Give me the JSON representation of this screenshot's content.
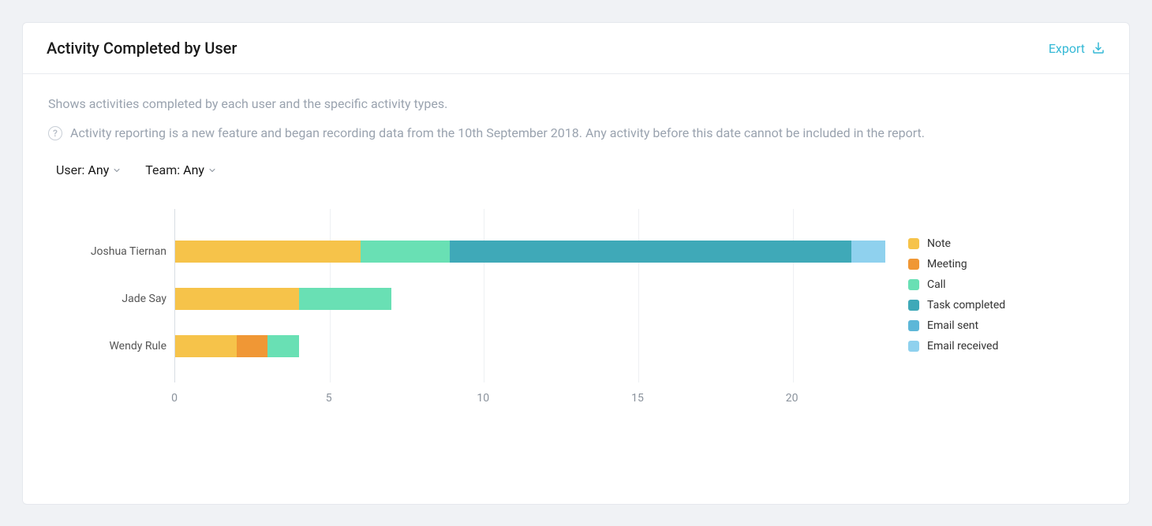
{
  "header": {
    "title": "Activity Completed by User",
    "export_label": "Export"
  },
  "body": {
    "description": "Shows activities completed by each user and the specific activity types.",
    "info_note": "Activity reporting is a new feature and began recording data from the 10th September 2018. Any activity before this date cannot be included in the report."
  },
  "filters": {
    "user": {
      "label": "User:",
      "value": "Any"
    },
    "team": {
      "label": "Team:",
      "value": "Any"
    }
  },
  "chart_data": {
    "type": "bar",
    "orientation": "horizontal",
    "stacked": true,
    "categories": [
      "Joshua Tiernan",
      "Jade Say",
      "Wendy Rule"
    ],
    "series": [
      {
        "name": "Note",
        "color": "#f6c34a",
        "values": [
          6.0,
          4.0,
          2.0
        ]
      },
      {
        "name": "Meeting",
        "color": "#f09735",
        "values": [
          0.0,
          0.0,
          1.0
        ]
      },
      {
        "name": "Call",
        "color": "#69e0b4",
        "values": [
          2.9,
          3.0,
          1.0
        ]
      },
      {
        "name": "Task completed",
        "color": "#3fa9b8",
        "values": [
          13.0,
          0.0,
          0.0
        ]
      },
      {
        "name": "Email sent",
        "color": "#5db7d8",
        "values": [
          0.0,
          0.0,
          0.0
        ]
      },
      {
        "name": "Email received",
        "color": "#8fd1ee",
        "values": [
          1.1,
          0.0,
          0.0
        ]
      }
    ],
    "x_ticks": [
      0,
      5,
      10,
      15,
      20
    ],
    "xlim": [
      0,
      23
    ],
    "xlabel": "",
    "ylabel": "",
    "title": ""
  }
}
